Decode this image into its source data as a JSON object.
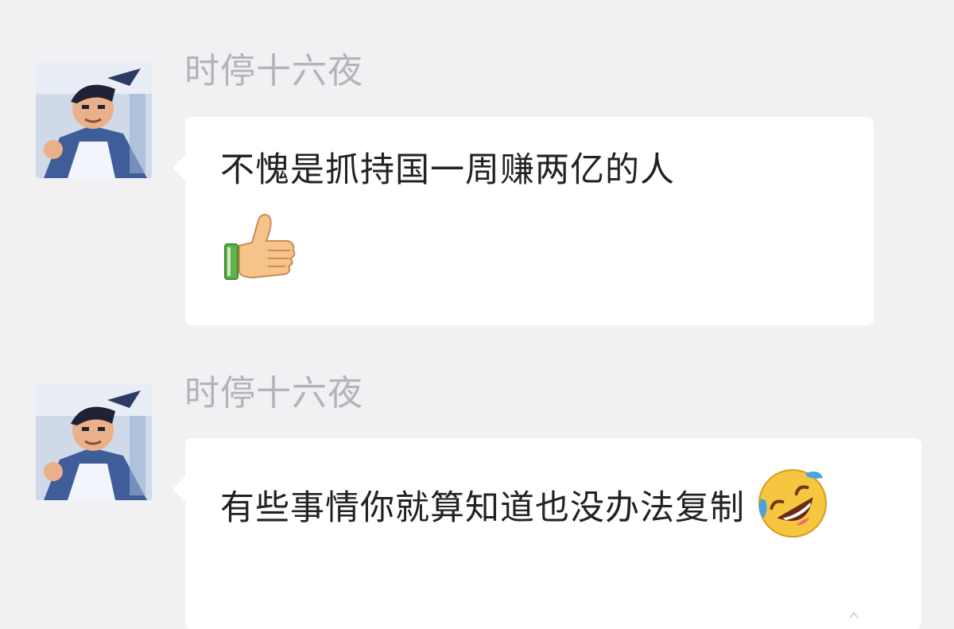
{
  "messages": [
    {
      "sender": "时停十六夜",
      "text": "不愧是抓持国一周赚两亿的人",
      "emoji": "thumbs-up-icon"
    },
    {
      "sender": "时停十六夜",
      "text": "有些事情你就算知道也没办法复制",
      "emoji": "rolling-on-floor-laughing-icon"
    }
  ],
  "colors": {
    "background": "#f1f1f3",
    "bubble": "#ffffff",
    "sender_name": "#b3b3b8",
    "message_text": "#222222"
  }
}
